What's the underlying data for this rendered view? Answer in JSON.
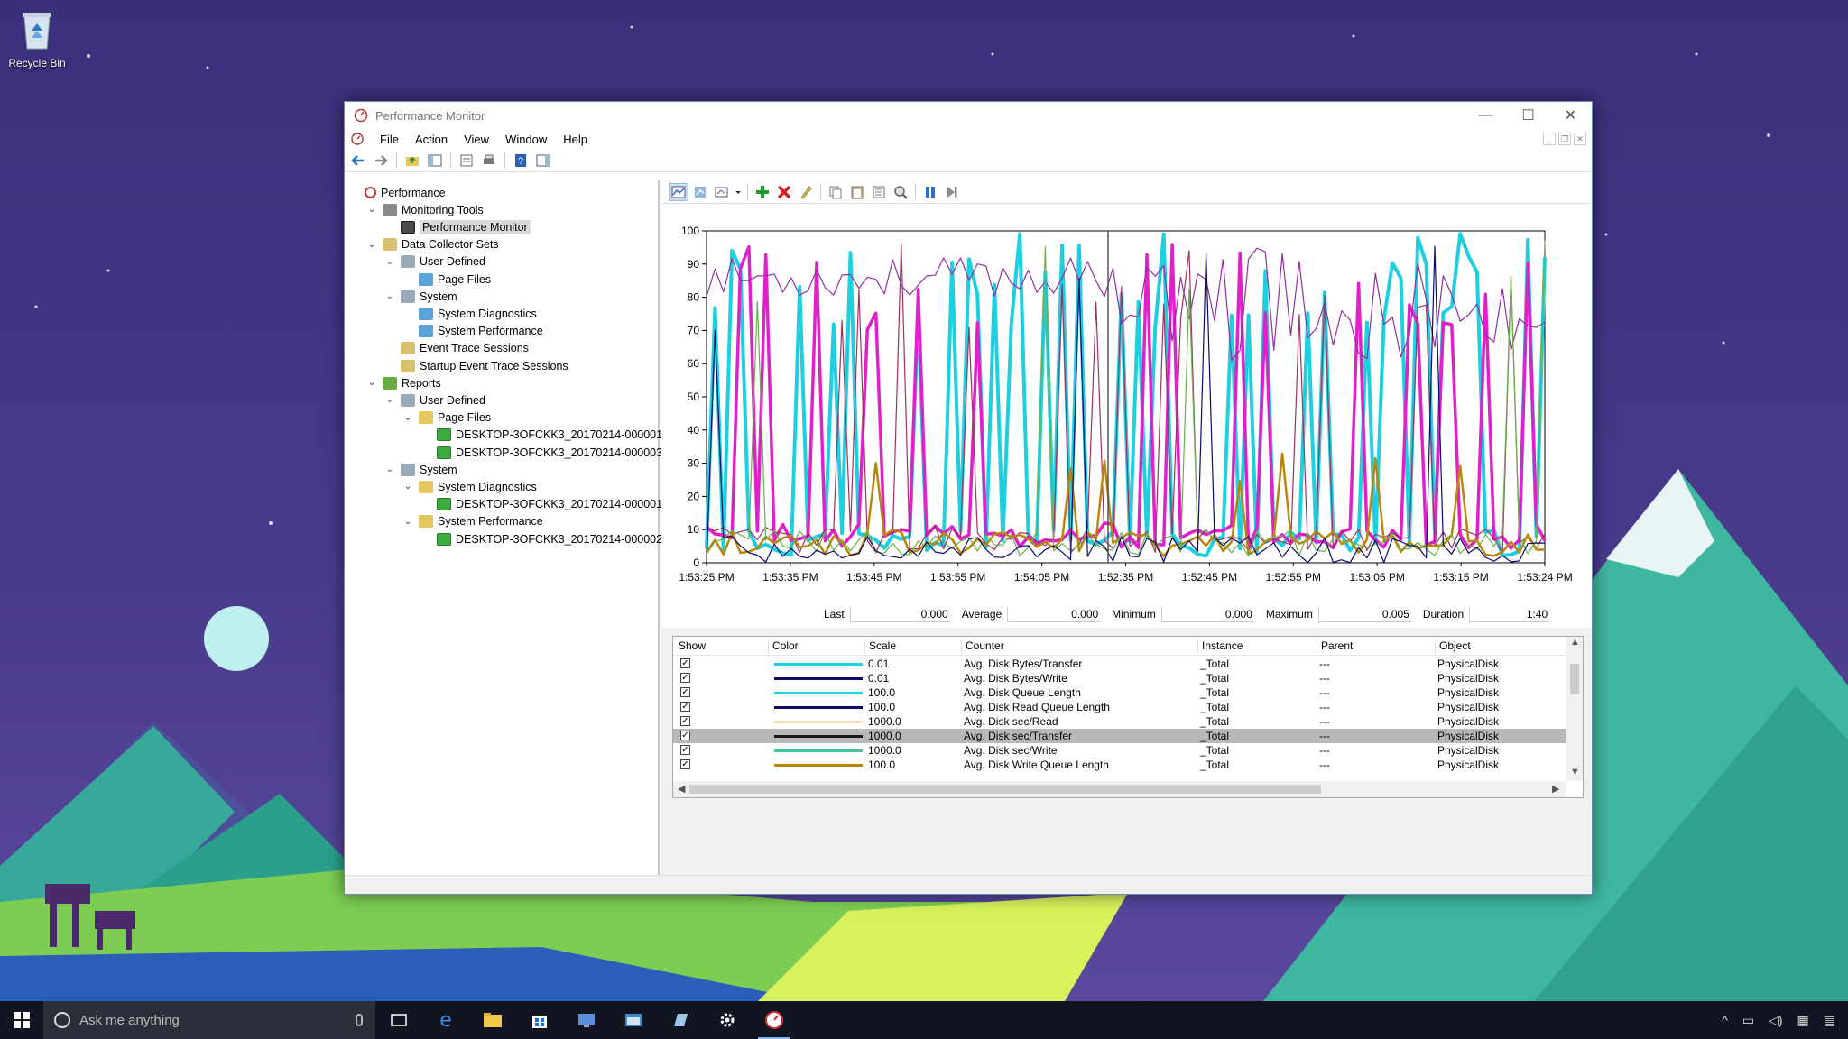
{
  "desktop": {
    "recycle_bin_label": "Recycle Bin"
  },
  "window": {
    "title": "Performance Monitor",
    "controls": {
      "minimize": "—",
      "maximize": "☐",
      "close": "✕"
    }
  },
  "menu": [
    "File",
    "Action",
    "View",
    "Window",
    "Help"
  ],
  "tree": [
    {
      "label": "Performance",
      "icon": "performance-icon",
      "level": 0,
      "exp": ""
    },
    {
      "label": "Monitoring Tools",
      "icon": "tools-icon",
      "level": 1,
      "exp": "v"
    },
    {
      "label": "Performance Monitor",
      "icon": "monitor-icon",
      "level": 2,
      "exp": "",
      "selected": true
    },
    {
      "label": "Data Collector Sets",
      "icon": "collector-sets-icon",
      "level": 1,
      "exp": "v"
    },
    {
      "label": "User Defined",
      "icon": "group-icon",
      "level": 2,
      "exp": "v"
    },
    {
      "label": "Page Files",
      "icon": "collector-icon",
      "level": 3,
      "exp": ""
    },
    {
      "label": "System",
      "icon": "group-icon",
      "level": 2,
      "exp": "v"
    },
    {
      "label": "System Diagnostics",
      "icon": "collector-icon",
      "level": 3,
      "exp": ""
    },
    {
      "label": "System Performance",
      "icon": "collector-icon",
      "level": 3,
      "exp": ""
    },
    {
      "label": "Event Trace Sessions",
      "icon": "trace-icon",
      "level": 2,
      "exp": ""
    },
    {
      "label": "Startup Event Trace Sessions",
      "icon": "trace-icon",
      "level": 2,
      "exp": ""
    },
    {
      "label": "Reports",
      "icon": "reports-icon",
      "level": 1,
      "exp": "v"
    },
    {
      "label": "User Defined",
      "icon": "group-icon",
      "level": 2,
      "exp": "v"
    },
    {
      "label": "Page Files",
      "icon": "folder-icon",
      "level": 3,
      "exp": "v"
    },
    {
      "label": "DESKTOP-3OFCKK3_20170214-000001",
      "icon": "report-icon",
      "level": 4,
      "exp": ""
    },
    {
      "label": "DESKTOP-3OFCKK3_20170214-000003",
      "icon": "report-icon",
      "level": 4,
      "exp": ""
    },
    {
      "label": "System",
      "icon": "group-icon",
      "level": 2,
      "exp": "v"
    },
    {
      "label": "System Diagnostics",
      "icon": "folder-icon",
      "level": 3,
      "exp": "v"
    },
    {
      "label": "DESKTOP-3OFCKK3_20170214-000001",
      "icon": "report-icon",
      "level": 4,
      "exp": ""
    },
    {
      "label": "System Performance",
      "icon": "folder-icon",
      "level": 3,
      "exp": "v"
    },
    {
      "label": "DESKTOP-3OFCKK3_20170214-000002",
      "icon": "report-icon",
      "level": 4,
      "exp": ""
    }
  ],
  "stats": {
    "last_label": "Last",
    "last_value": "0.000",
    "average_label": "Average",
    "average_value": "0.000",
    "minimum_label": "Minimum",
    "minimum_value": "0.000",
    "maximum_label": "Maximum",
    "maximum_value": "0.005",
    "duration_label": "Duration",
    "duration_value": "1:40"
  },
  "legend": {
    "headers": [
      "Show",
      "Color",
      "Scale",
      "Counter",
      "Instance",
      "Parent",
      "Object"
    ],
    "rows": [
      {
        "show": true,
        "color": "#1ecfe0",
        "scale": "0.01",
        "counter": "Avg. Disk Bytes/Transfer",
        "instance": "_Total",
        "parent": "---",
        "object": "PhysicalDisk"
      },
      {
        "show": true,
        "color": "#0a0a6e",
        "scale": "0.01",
        "counter": "Avg. Disk Bytes/Write",
        "instance": "_Total",
        "parent": "---",
        "object": "PhysicalDisk"
      },
      {
        "show": true,
        "color": "#20d8e8",
        "scale": "100.0",
        "counter": "Avg. Disk Queue Length",
        "instance": "_Total",
        "parent": "---",
        "object": "PhysicalDisk"
      },
      {
        "show": true,
        "color": "#0a0a6e",
        "scale": "100.0",
        "counter": "Avg. Disk Read Queue Length",
        "instance": "_Total",
        "parent": "---",
        "object": "PhysicalDisk"
      },
      {
        "show": true,
        "color": "#f5deb3",
        "scale": "1000.0",
        "counter": "Avg. Disk sec/Read",
        "instance": "_Total",
        "parent": "---",
        "object": "PhysicalDisk"
      },
      {
        "show": true,
        "color": "#1a1a1a",
        "scale": "1000.0",
        "counter": "Avg. Disk sec/Transfer",
        "instance": "_Total",
        "parent": "---",
        "object": "PhysicalDisk",
        "selected": true
      },
      {
        "show": true,
        "color": "#3cc9a0",
        "scale": "1000.0",
        "counter": "Avg. Disk sec/Write",
        "instance": "_Total",
        "parent": "---",
        "object": "PhysicalDisk"
      },
      {
        "show": true,
        "color": "#b8860b",
        "scale": "100.0",
        "counter": "Avg. Disk Write Queue Length",
        "instance": "_Total",
        "parent": "---",
        "object": "PhysicalDisk"
      }
    ]
  },
  "chart_data": {
    "type": "line",
    "title": "",
    "ylim": [
      0,
      100
    ],
    "yticks": [
      0,
      10,
      20,
      30,
      40,
      50,
      60,
      70,
      80,
      90,
      100
    ],
    "xticks": [
      "1:53:25 PM",
      "1:53:35 PM",
      "1:53:45 PM",
      "1:53:55 PM",
      "1:54:05 PM",
      "1:52:35 PM",
      "1:52:45 PM",
      "1:52:55 PM",
      "1:53:05 PM",
      "1:53:15 PM",
      "1:53:24 PM"
    ],
    "points_per_series": 100,
    "series": [
      {
        "color": "#1ecfe0",
        "kind": "spiky",
        "seed": 11,
        "density": 0.34,
        "low": 2,
        "high": 100
      },
      {
        "color": "#e020c8",
        "kind": "spiky",
        "seed": 23,
        "density": 0.2,
        "low": 4,
        "high": 100
      },
      {
        "color": "#a03060",
        "kind": "thin",
        "seed": 37,
        "density": 0.16,
        "low": 3,
        "high": 100
      },
      {
        "color": "#b8860b",
        "kind": "low",
        "seed": 41,
        "density": 0.12,
        "low": 2,
        "high": 35
      },
      {
        "color": "#9030a0",
        "kind": "upper",
        "seed": 53,
        "density": 0.0,
        "low": 80,
        "high": 92
      },
      {
        "color": "#6ab04c",
        "kind": "thin",
        "seed": 61,
        "density": 0.08,
        "low": 2,
        "high": 100
      },
      {
        "color": "#0a0a6e",
        "kind": "thin",
        "seed": 71,
        "density": 0.04,
        "low": 0,
        "high": 100
      }
    ]
  },
  "taskbar": {
    "search_placeholder": "Ask me anything"
  }
}
